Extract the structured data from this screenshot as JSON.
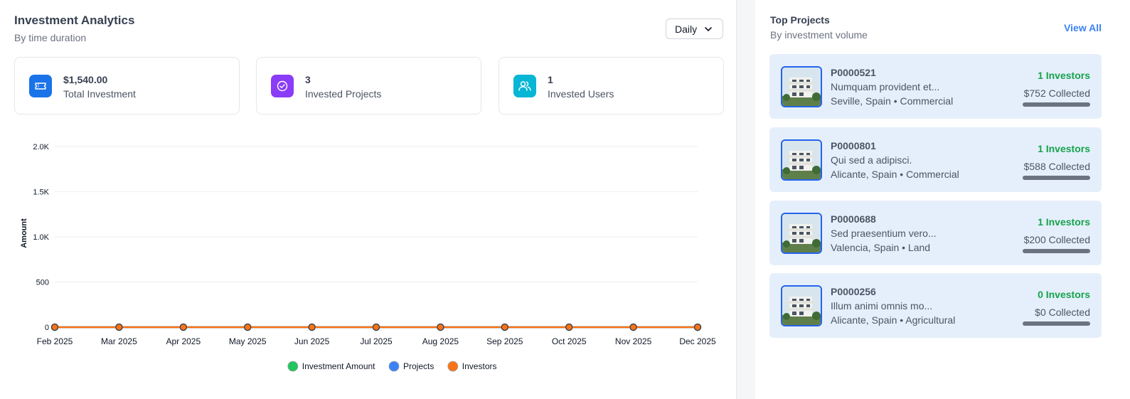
{
  "analytics": {
    "title": "Investment Analytics",
    "subtitle": "By time duration",
    "period_select": "Daily"
  },
  "stats": [
    {
      "value": "$1,540.00",
      "label": "Total Investment",
      "icon": "ticket-icon",
      "color": "#1a73e8"
    },
    {
      "value": "3",
      "label": "Invested Projects",
      "icon": "check-circle-icon",
      "color": "#8b3cf7"
    },
    {
      "value": "1",
      "label": "Invested Users",
      "icon": "users-icon",
      "color": "#06b6d4"
    }
  ],
  "chart_data": {
    "type": "line",
    "categories": [
      "Feb 2025",
      "Mar 2025",
      "Apr 2025",
      "May 2025",
      "Jun 2025",
      "Jul 2025",
      "Aug 2025",
      "Sep 2025",
      "Oct 2025",
      "Nov 2025",
      "Dec 2025"
    ],
    "series": [
      {
        "name": "Investment Amount",
        "color": "#22c55e",
        "values": [
          0,
          0,
          0,
          0,
          0,
          0,
          0,
          0,
          0,
          0,
          0
        ]
      },
      {
        "name": "Projects",
        "color": "#3b82f6",
        "values": [
          0,
          0,
          0,
          0,
          0,
          0,
          0,
          0,
          0,
          0,
          0
        ]
      },
      {
        "name": "Investors",
        "color": "#f97316",
        "values": [
          0,
          0,
          0,
          0,
          0,
          0,
          0,
          0,
          0,
          0,
          0
        ]
      }
    ],
    "ylabel": "Amount",
    "ylim": [
      0,
      2000
    ],
    "yticks": [
      {
        "value": 0,
        "label": "0"
      },
      {
        "value": 500,
        "label": "500"
      },
      {
        "value": 1000,
        "label": "1.0K"
      },
      {
        "value": 1500,
        "label": "1.5K"
      },
      {
        "value": 2000,
        "label": "2.0K"
      }
    ],
    "grid": true,
    "legend": "bottom-center"
  },
  "top_projects": {
    "title": "Top Projects",
    "subtitle": "By investment volume",
    "view_all": "View All",
    "items": [
      {
        "code": "P0000521",
        "desc": "Numquam provident et...",
        "location": "Seville, Spain • Commercial",
        "investors": "1 Investors",
        "collected": "$752 Collected"
      },
      {
        "code": "P0000801",
        "desc": "Qui sed a adipisci.",
        "location": "Alicante, Spain • Commercial",
        "investors": "1 Investors",
        "collected": "$588 Collected"
      },
      {
        "code": "P0000688",
        "desc": "Sed praesentium vero...",
        "location": "Valencia, Spain • Land",
        "investors": "1 Investors",
        "collected": "$200 Collected"
      },
      {
        "code": "P0000256",
        "desc": "Illum animi omnis mo...",
        "location": "Alicante, Spain • Agricultural",
        "investors": "0 Investors",
        "collected": "$0 Collected"
      }
    ]
  }
}
